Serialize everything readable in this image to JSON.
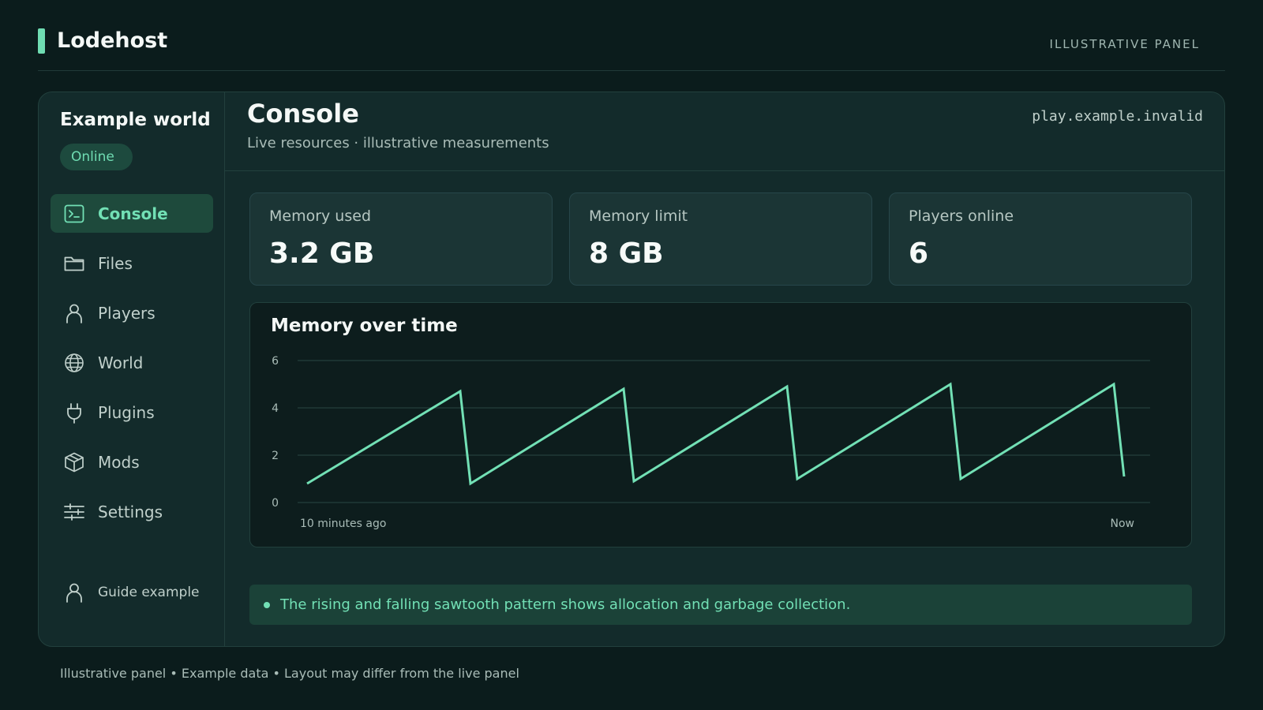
{
  "app": {
    "name": "Lodehost",
    "top_label": "ILLUSTRATIVE PANEL"
  },
  "sidebar": {
    "world_name": "Example world",
    "status": "Online",
    "items": [
      {
        "label": "Console",
        "icon": "terminal-icon",
        "active": true
      },
      {
        "label": "Files",
        "icon": "folder-icon"
      },
      {
        "label": "Players",
        "icon": "person-icon"
      },
      {
        "label": "World",
        "icon": "globe-icon"
      },
      {
        "label": "Plugins",
        "icon": "plug-icon"
      },
      {
        "label": "Mods",
        "icon": "cube-icon"
      },
      {
        "label": "Settings",
        "icon": "sliders-icon"
      }
    ],
    "guide": {
      "label": "Guide example",
      "icon": "person-icon"
    }
  },
  "main": {
    "title": "Console",
    "subtitle": "Live resources · illustrative measurements",
    "address": "play.example.invalid",
    "stats": [
      {
        "label": "Memory used",
        "value": "3.2 GB"
      },
      {
        "label": "Memory limit",
        "value": "8 GB"
      },
      {
        "label": "Players online",
        "value": "6"
      }
    ],
    "note": "The rising and falling sawtooth pattern shows allocation and garbage collection."
  },
  "chart_data": {
    "type": "line",
    "title": "Memory over time",
    "x_start_label": "10 minutes ago",
    "x_end_label": "Now",
    "ylim": [
      0,
      6
    ],
    "yticks": [
      0,
      2,
      4,
      6
    ],
    "grid": true,
    "color": "#72e0b5",
    "series": [
      {
        "values": [
          0.8,
          4.7,
          0.8,
          4.8,
          0.9,
          4.9,
          1.0,
          5.0,
          1.0,
          5.0,
          1.1
        ]
      }
    ]
  },
  "footer": "Illustrative panel • Example data • Layout may differ from the live panel",
  "colors": {
    "background": "#0b1c1c",
    "accent": "#6fdcb2",
    "panel": "#132b2b"
  }
}
